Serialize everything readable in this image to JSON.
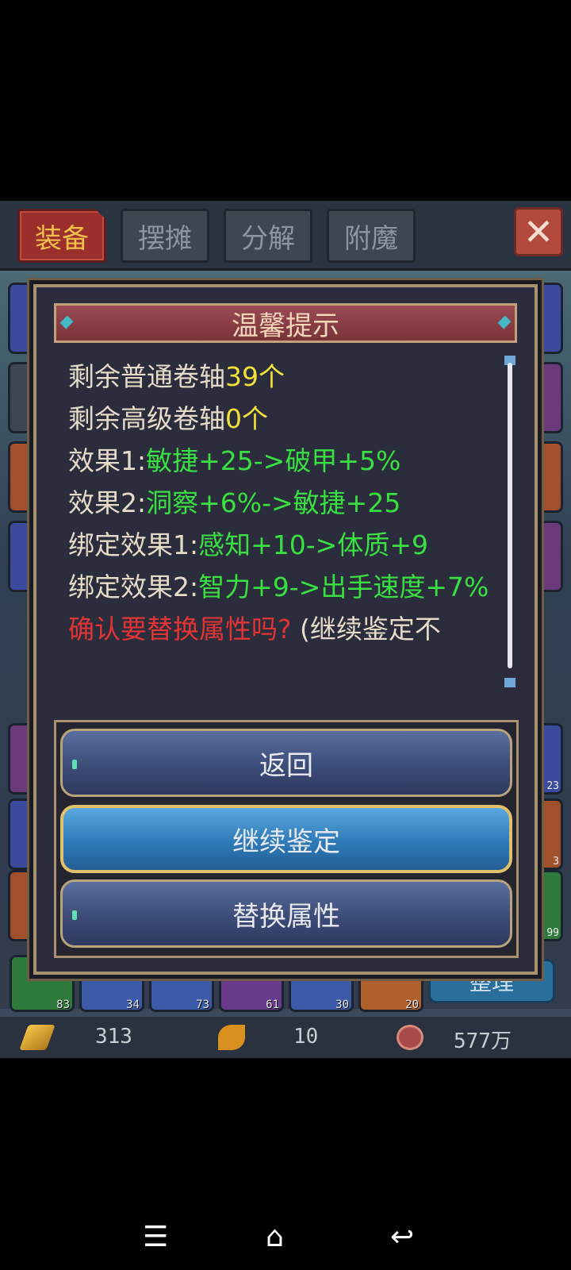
{
  "tabs": [
    {
      "label": "装备",
      "active": true
    },
    {
      "label": "摆摊",
      "active": false
    },
    {
      "label": "分解",
      "active": false
    },
    {
      "label": "附魔",
      "active": false
    }
  ],
  "close_icon": "close-icon",
  "dialog": {
    "title": "温馨提示",
    "lines": [
      {
        "label": "剩余普通卷轴",
        "value": "39个"
      },
      {
        "label": "剩余高级卷轴",
        "value": "0个"
      },
      {
        "label": "效果1:",
        "value": "敏捷+25->破甲+5%"
      },
      {
        "label": "效果2:",
        "value": "洞察+6%->敏捷+25"
      },
      {
        "label": "绑定效果1:",
        "value": "感知+10->体质+9"
      },
      {
        "label": "绑定效果2:",
        "value": "智力+9->出手速度+7%"
      }
    ],
    "confirm_question": "确认要替换属性吗?",
    "confirm_note": " (继续鉴定不",
    "buttons": {
      "back": "返回",
      "continue": "继续鉴定",
      "replace": "替换属性"
    }
  },
  "inventory": {
    "items": [
      {
        "count": "83"
      },
      {
        "count": "34"
      },
      {
        "count": "73"
      },
      {
        "count": "61"
      },
      {
        "count": "30"
      },
      {
        "count": "20"
      }
    ],
    "side_counts": [
      "23",
      "3",
      "99"
    ],
    "sort_label": "整理"
  },
  "currency": {
    "gold": "313",
    "leaf": "10",
    "coin": "577万"
  },
  "colors": {
    "highlight_yellow": "#f3e23a",
    "effect_green": "#39e041",
    "warning_red": "#e23434"
  }
}
